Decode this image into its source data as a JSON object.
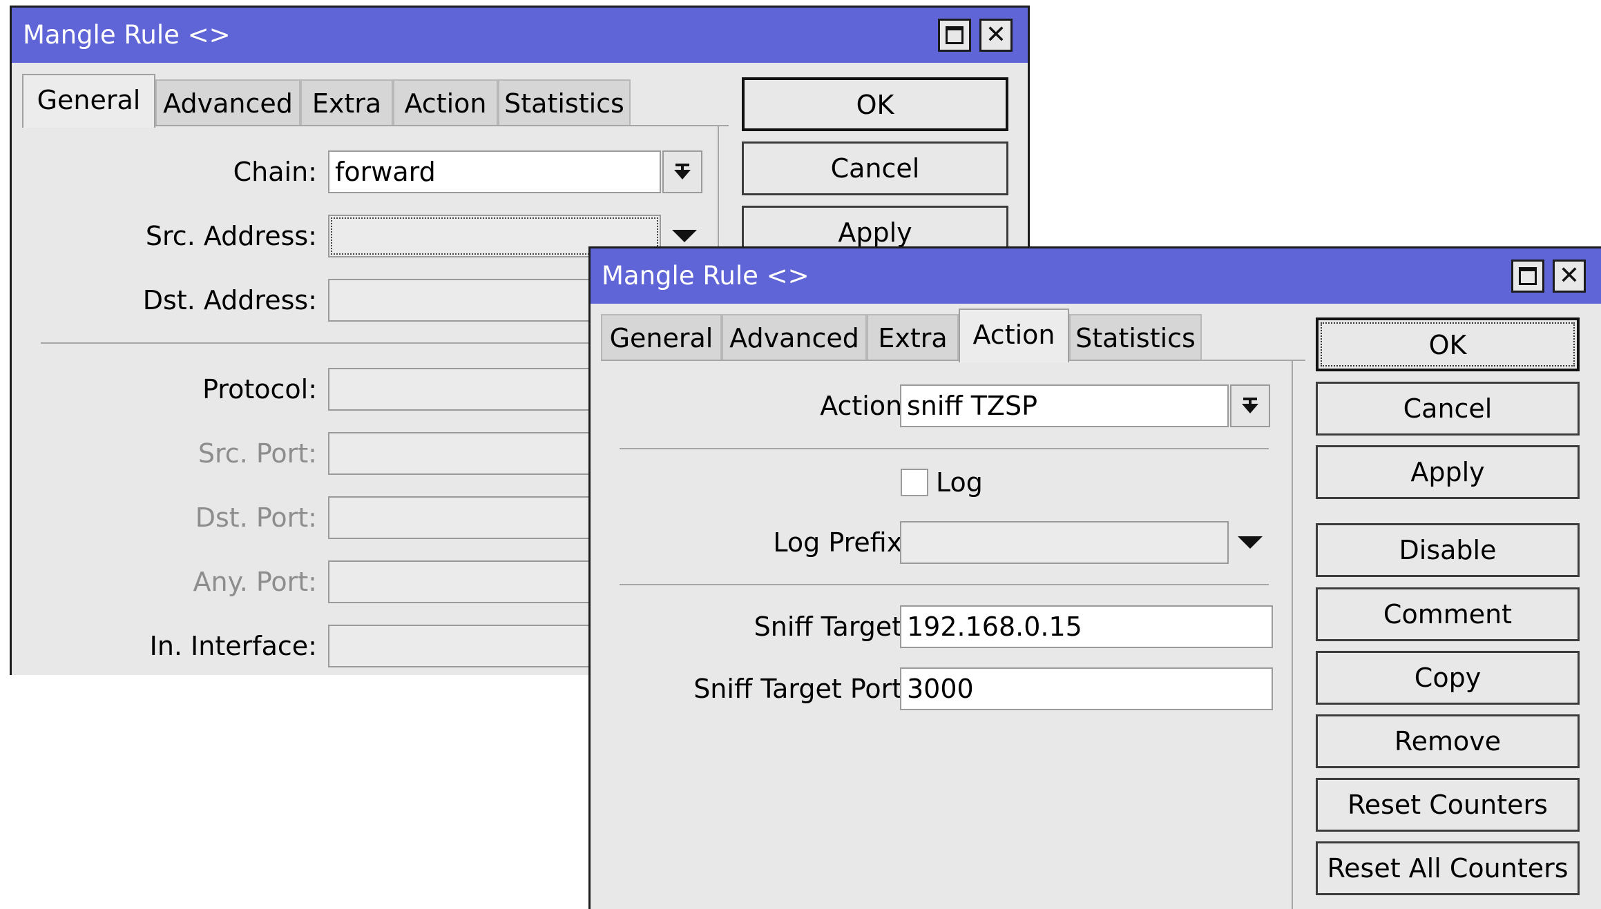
{
  "window1": {
    "title": "Mangle Rule <>",
    "tabs": [
      "General",
      "Advanced",
      "Extra",
      "Action",
      "Statistics"
    ],
    "active_tab": "General",
    "fields": {
      "chain_label": "Chain:",
      "chain_value": "forward",
      "src_address_label": "Src. Address:",
      "dst_address_label": "Dst. Address:",
      "protocol_label": "Protocol:",
      "src_port_label": "Src. Port:",
      "dst_port_label": "Dst. Port:",
      "any_port_label": "Any. Port:",
      "in_interface_label": "In. Interface:"
    },
    "buttons": {
      "ok": "OK",
      "cancel": "Cancel",
      "apply": "Apply"
    }
  },
  "window2": {
    "title": "Mangle Rule <>",
    "tabs": [
      "General",
      "Advanced",
      "Extra",
      "Action",
      "Statistics"
    ],
    "active_tab": "Action",
    "fields": {
      "action_label": "Action:",
      "action_value": "sniff TZSP",
      "log_label": "Log",
      "log_checked": false,
      "log_prefix_label": "Log Prefix:",
      "sniff_target_label": "Sniff Target:",
      "sniff_target_value": "192.168.0.15",
      "sniff_target_port_label": "Sniff Target Port:",
      "sniff_target_port_value": "3000"
    },
    "buttons": {
      "ok": "OK",
      "cancel": "Cancel",
      "apply": "Apply",
      "disable": "Disable",
      "comment": "Comment",
      "copy": "Copy",
      "remove": "Remove",
      "reset_counters": "Reset Counters",
      "reset_all_counters": "Reset All Counters"
    }
  },
  "colors": {
    "titlebar": "#5f65d6",
    "window_bg": "#e8e8e8"
  },
  "icons": {
    "maximize": "maximize-icon",
    "close": "close-icon",
    "dropdown": "dropdown-arrow-icon"
  }
}
